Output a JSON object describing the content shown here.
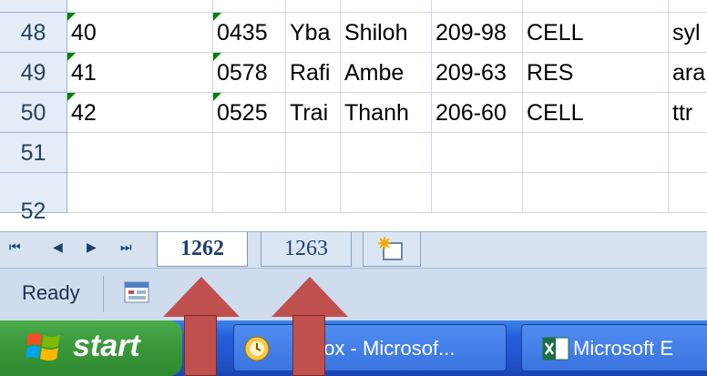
{
  "grid": {
    "rows": [
      {
        "num": "48",
        "cells": [
          "40",
          "",
          "0435",
          "Yba",
          "Shiloh",
          "209-98",
          "CELL",
          "",
          "syl"
        ]
      },
      {
        "num": "49",
        "cells": [
          "41",
          "",
          "0578",
          "Rafi",
          "Ambe",
          "209-63",
          "RES",
          "",
          "ara"
        ]
      },
      {
        "num": "50",
        "cells": [
          "42",
          "",
          "0525",
          "Trai",
          "Thanh",
          "206-60",
          "CELL",
          "",
          "ttr"
        ]
      },
      {
        "num": "51",
        "cells": [
          "",
          "",
          "",
          "",
          "",
          "",
          "",
          "",
          ""
        ]
      },
      {
        "num": "52",
        "cells": [
          "",
          "",
          "",
          "",
          "",
          "",
          "",
          "",
          ""
        ]
      }
    ]
  },
  "sheet_tabs": {
    "nav": [
      "⏮",
      "◀",
      "▶",
      "⏭"
    ],
    "tabs": [
      {
        "label": "1262",
        "active": true
      },
      {
        "label": "1263",
        "active": false
      }
    ],
    "new_sheet_icon": "insert-sheet-icon"
  },
  "status": {
    "text": "Ready",
    "macro_icon": "record-macro-icon"
  },
  "taskbar": {
    "start_label": "start",
    "buttons": [
      {
        "label": "box - Microsof...",
        "icon": "outlook-icon"
      },
      {
        "label": "Microsoft E",
        "icon": "excel-icon"
      }
    ]
  },
  "colors": {
    "accent_arrow": "#c0504d",
    "taskbar_blue": "#245edb",
    "start_green": "#3c9a3c"
  }
}
